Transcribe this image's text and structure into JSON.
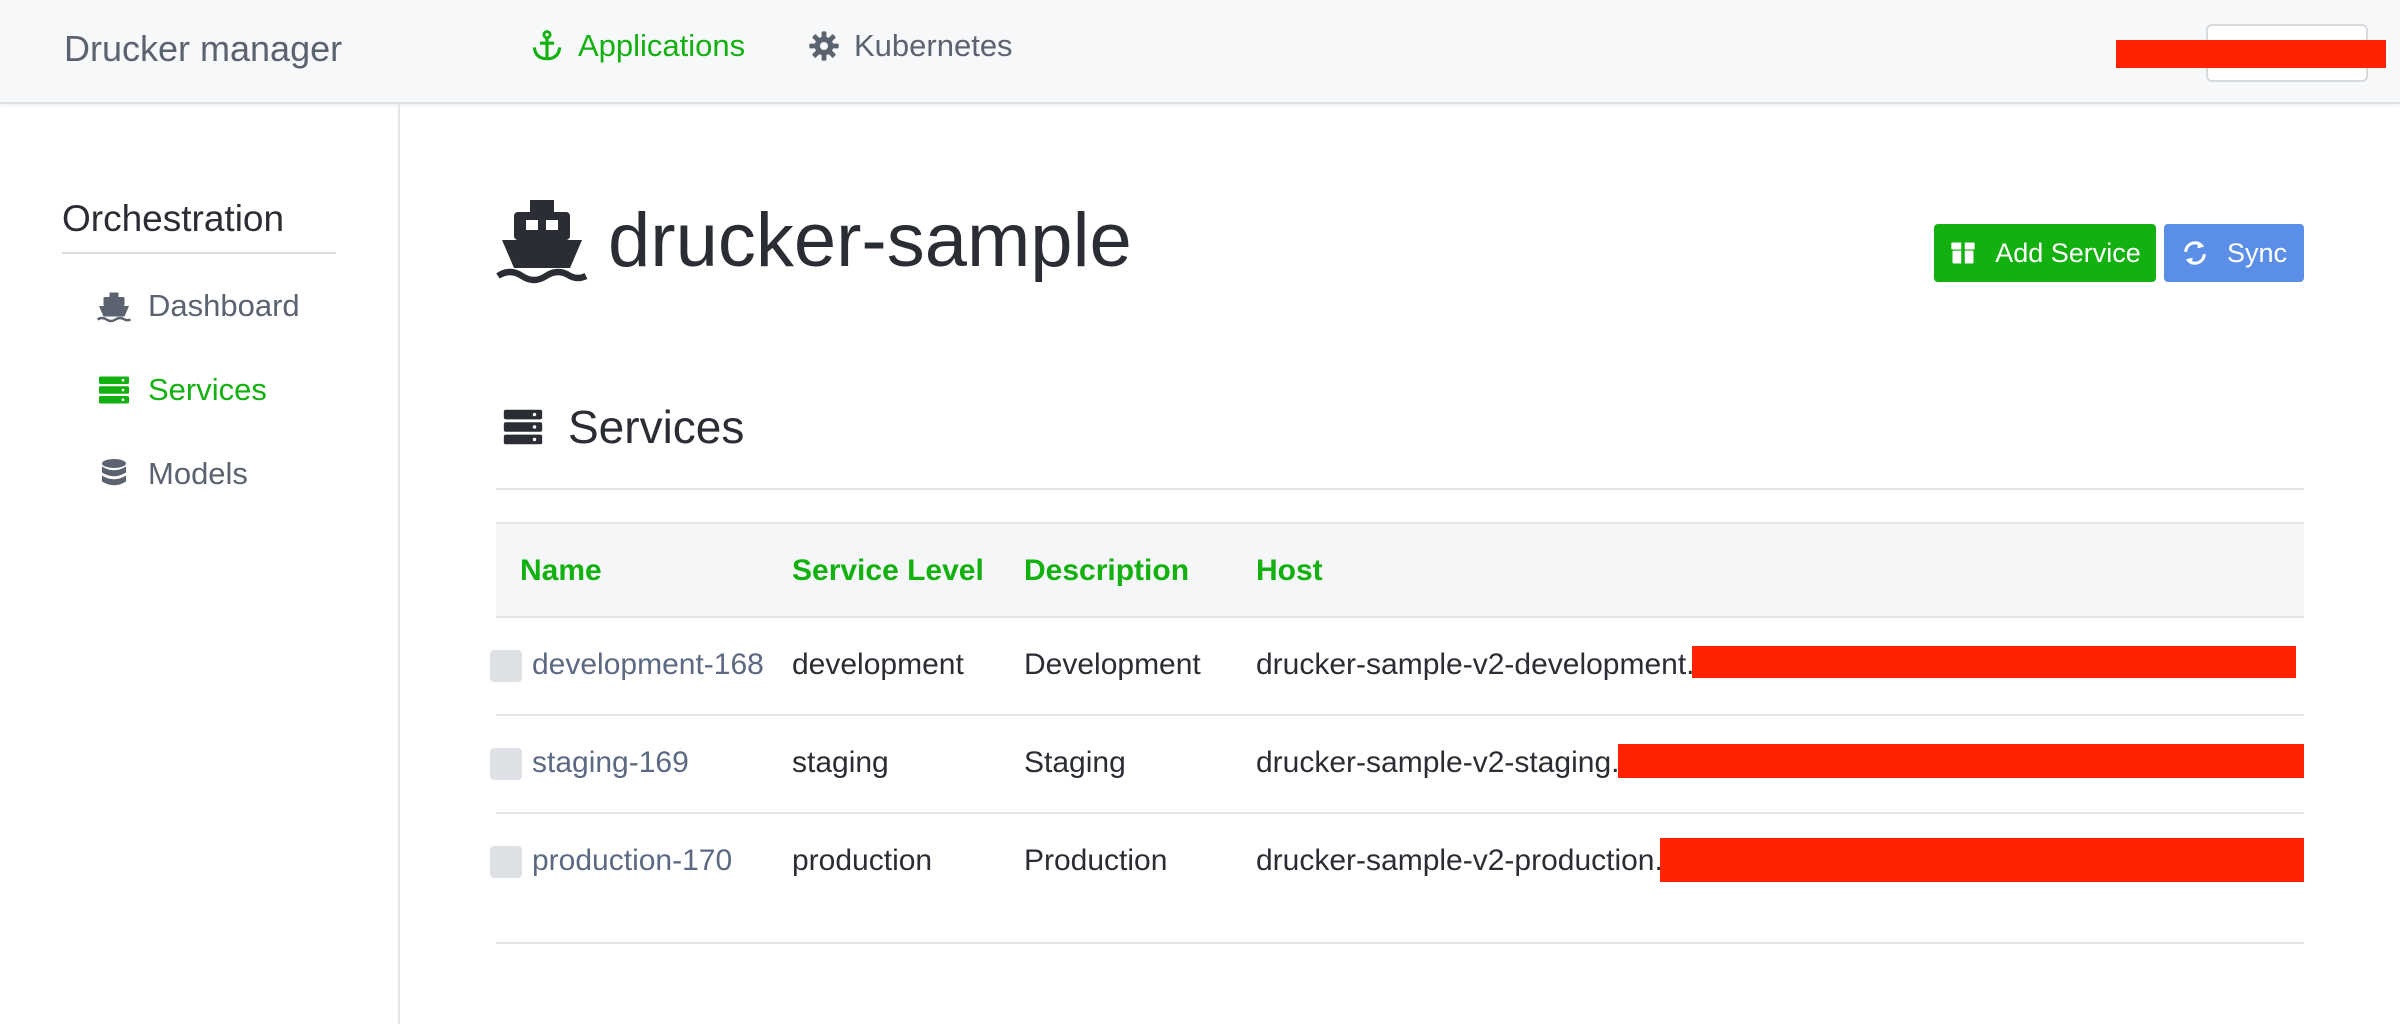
{
  "navbar": {
    "brand": "Drucker manager",
    "links": [
      {
        "label": "Applications",
        "icon": "anchor-icon"
      },
      {
        "label": "Kubernetes",
        "icon": "gear-icon"
      }
    ]
  },
  "sidebar": {
    "heading": "Orchestration",
    "items": [
      {
        "label": "Dashboard",
        "icon": "ship-icon"
      },
      {
        "label": "Services",
        "icon": "server-icon"
      },
      {
        "label": "Models",
        "icon": "database-icon"
      }
    ]
  },
  "main": {
    "title": "drucker-sample",
    "buttons": {
      "add_service": "Add Service",
      "sync": "Sync"
    },
    "section_title": "Services",
    "table": {
      "columns": [
        "Name",
        "Service Level",
        "Description",
        "Host"
      ],
      "rows": [
        {
          "name": "development-168",
          "level": "development",
          "description": "Development",
          "host": "drucker-sample-v2-development."
        },
        {
          "name": "staging-169",
          "level": "staging",
          "description": "Staging",
          "host": "drucker-sample-v2-staging."
        },
        {
          "name": "production-170",
          "level": "production",
          "description": "Production",
          "host": "drucker-sample-v2-production."
        }
      ]
    }
  },
  "colors": {
    "accent": "#12b10f",
    "sync": "#5b8ee6",
    "redaction": "#ff2300"
  }
}
